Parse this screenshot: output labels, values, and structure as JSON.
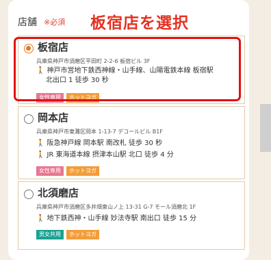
{
  "section": {
    "label": "店舗",
    "required": "※必須"
  },
  "annotation": "板宿店を選択",
  "stores": [
    {
      "name": "板宿店",
      "selected": true,
      "address": "兵庫県神戸市須磨区平田町 2-2-6 板宿ビル 3F",
      "access": [
        "神戸市営地下鉄西神線・山手線、山陽電鉄本線 板宿駅",
        "北出口 1 徒歩 30 秒"
      ],
      "tags": [
        "女性専用",
        "ホットヨガ"
      ]
    },
    {
      "name": "岡本店",
      "selected": false,
      "address": "兵庫県神戸市東灘区岡本 1-13-7 デコールビル B1F",
      "access": [
        "阪急神戸線 岡本駅 南改札 徒歩 30 秒",
        "JR 東海道本線 摂津本山駅 北口 徒歩 4 分"
      ],
      "tags": [
        "女性専用",
        "ホットヨガ"
      ]
    },
    {
      "name": "北須磨店",
      "selected": false,
      "address": "兵庫県神戸市須磨区多井畑東山ノ上 13-31 G-7 モール須磨北 1F",
      "access": [
        "地下鉄西神・山手線 妙法寺駅 南出口 徒歩 15 分"
      ],
      "tags": [
        "男女共用",
        "ホットヨガ"
      ]
    }
  ],
  "colors": {
    "accent": "#e07a2a",
    "annotation": "#e53222",
    "women": "#e87691",
    "hotyoga": "#f29d38",
    "unisex": "#1aa292"
  }
}
